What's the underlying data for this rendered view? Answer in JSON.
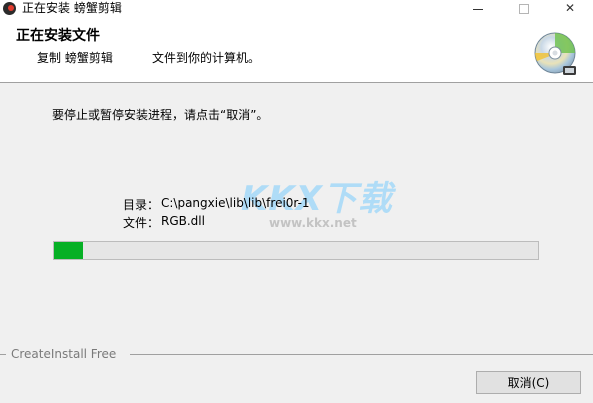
{
  "window": {
    "title": "正在安装 螃蟹剪辑",
    "controls": {
      "minimize_icon": "minimize-icon",
      "maximize_glyph": "□",
      "close_glyph": "✕"
    }
  },
  "header": {
    "title": "正在安装文件",
    "subtitle_action": "复制 螃蟹剪辑",
    "subtitle_detail": "文件到你的计算机。",
    "icon": "disc-icon"
  },
  "main": {
    "instruction": "要停止或暂停安装进程，请点击“取消”。",
    "directory_label": "目录：",
    "directory_value": "C:\\pangxie\\lib\\lib\\frei0r-1",
    "file_label": "文件：",
    "file_value": "RGB.dll",
    "progress_percent": 6
  },
  "watermark": {
    "logo_text": "KKX下载",
    "url": "www.kkx.net"
  },
  "footer": {
    "brand": "CreateInstall Free",
    "cancel_label": "取消(C)"
  },
  "colors": {
    "progress_fill": "#06b025",
    "progress_track": "#e6e6e6",
    "window_bg": "#f0f0f0"
  }
}
